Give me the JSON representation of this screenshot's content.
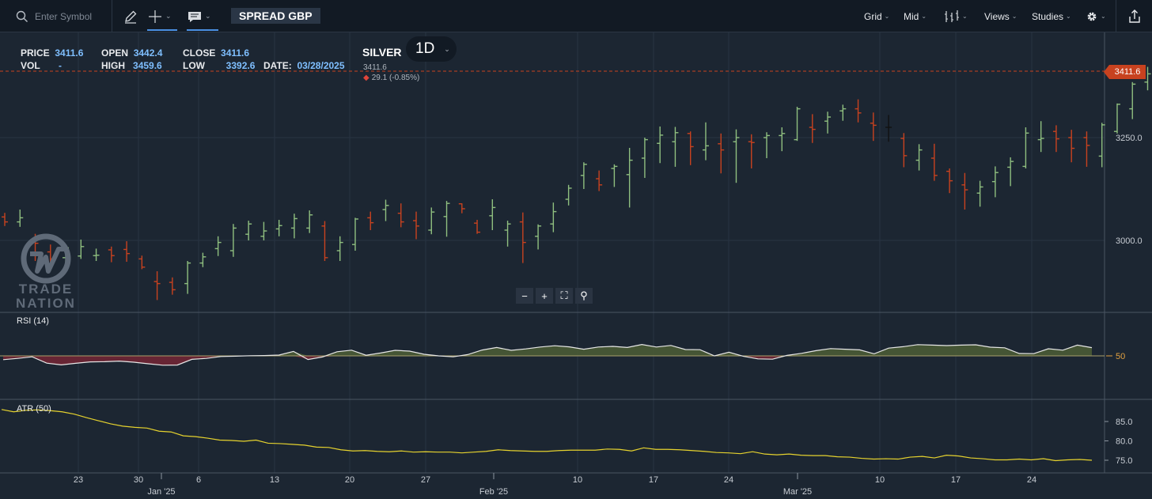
{
  "toolbar": {
    "search_placeholder": "Enter Symbol",
    "symbol": "SPREAD GBP",
    "right": {
      "grid": "Grid",
      "mid": "Mid",
      "views": "Views",
      "studies": "Studies"
    },
    "icons": [
      "search-icon",
      "pencil-icon",
      "crosshair-icon",
      "comment-icon",
      "bar-style-icon",
      "gear-icon",
      "share-icon"
    ]
  },
  "header": {
    "price_label": "PRICE",
    "price": "3411.6",
    "vol_label": "VOL",
    "vol": "-",
    "open_label": "OPEN",
    "open": "3442.4",
    "high_label": "HIGH",
    "high": "3459.6",
    "close_label": "CLOSE",
    "close": "3411.6",
    "low_label": "LOW",
    "low": "3392.6",
    "date_label": "DATE:",
    "date": "03/28/2025"
  },
  "instrument": {
    "name": "SILVER",
    "timeframe": "1D",
    "last": "3411.6",
    "change": "29.1 (-0.85%)"
  },
  "last_price_badge": "3411.6",
  "watermark": {
    "text_top": "TRADE",
    "text_bottom": "NATION"
  },
  "zoom_controls": [
    "minus-icon",
    "plus-icon",
    "fullscreen-icon",
    "zoom-reset-icon"
  ],
  "colors": {
    "up": "#8fbf7f",
    "down": "#c8421f",
    "neutral": "#111111",
    "rsi_up_fill": "#4a5b35",
    "rsi_down_fill": "#6b2535",
    "atr_line": "#e5d22e",
    "last_price": "#c8421f"
  },
  "chart_data": [
    {
      "type": "ohlc",
      "title": "SILVER",
      "y_ticks": [
        "3250.0",
        "3000.0"
      ],
      "ylim": [
        2880,
        3560
      ],
      "x_labels": [
        "23",
        "30",
        "6",
        "13",
        "20",
        "27",
        "10",
        "17",
        "24",
        "10",
        "17",
        "24"
      ],
      "x_month_labels": [
        "Jan '25",
        "Feb '25",
        "Mar '25"
      ],
      "last_price": 3411.6,
      "bars": [
        [
          3057,
          3067,
          3035,
          3045
        ],
        [
          3045,
          3075,
          3033,
          3055
        ],
        [
          2999,
          3016,
          2950,
          2993
        ],
        [
          2972,
          2990,
          2935,
          2955
        ],
        [
          2958,
          2989,
          2934,
          2982
        ],
        [
          2962,
          3002,
          2955,
          2985
        ],
        [
          2963,
          2980,
          2950,
          2964
        ],
        [
          2977,
          2985,
          2947,
          2963
        ],
        [
          2978,
          2998,
          2948,
          2968
        ],
        [
          2955,
          2963,
          2930,
          2935
        ],
        [
          2900,
          2925,
          2855,
          2895
        ],
        [
          2898,
          2910,
          2868,
          2880
        ],
        [
          2895,
          2950,
          2870,
          2945
        ],
        [
          2945,
          2970,
          2935,
          2960
        ],
        [
          2980,
          3010,
          2962,
          2995
        ],
        [
          2975,
          3040,
          2960,
          3030
        ],
        [
          3015,
          3048,
          3000,
          3040
        ],
        [
          3010,
          3045,
          3000,
          3023
        ],
        [
          3028,
          3050,
          3010,
          3036
        ],
        [
          3030,
          3065,
          3005,
          3053
        ],
        [
          3030,
          3073,
          3018,
          3062
        ],
        [
          3035,
          3047,
          2950,
          2958
        ],
        [
          2975,
          3010,
          2950,
          2995
        ],
        [
          2990,
          3055,
          2975,
          3052
        ],
        [
          3055,
          3070,
          3025,
          3043
        ],
        [
          3075,
          3099,
          3047,
          3085
        ],
        [
          3066,
          3090,
          3032,
          3045
        ],
        [
          3048,
          3070,
          3003,
          3035
        ],
        [
          3025,
          3080,
          3015,
          3069
        ],
        [
          3058,
          3096,
          3009,
          3090
        ],
        [
          3089,
          3090,
          3066,
          3077
        ],
        [
          3042,
          3050,
          3016,
          3020
        ],
        [
          3060,
          3100,
          3025,
          3080
        ],
        [
          3025,
          3048,
          2985,
          3040
        ],
        [
          3045,
          3068,
          2945,
          2995
        ],
        [
          3010,
          3039,
          2978,
          3035
        ],
        [
          3040,
          3092,
          3020,
          3070
        ],
        [
          3100,
          3135,
          3085,
          3127
        ],
        [
          3158,
          3190,
          3125,
          3185
        ],
        [
          3150,
          3170,
          3120,
          3135
        ],
        [
          3175,
          3185,
          3130,
          3180
        ],
        [
          3160,
          3225,
          3080,
          3195
        ],
        [
          3200,
          3250,
          3152,
          3245
        ],
        [
          3236,
          3277,
          3188,
          3256
        ],
        [
          3240,
          3276,
          3179,
          3262
        ],
        [
          3260,
          3265,
          3183,
          3228
        ],
        [
          3220,
          3287,
          3195,
          3230
        ],
        [
          3235,
          3260,
          3163,
          3220
        ],
        [
          3240,
          3270,
          3140,
          3250
        ],
        [
          3240,
          3258,
          3175,
          3238
        ],
        [
          3250,
          3263,
          3200,
          3255
        ],
        [
          3255,
          3275,
          3217,
          3260
        ],
        [
          3245,
          3325,
          3242,
          3320
        ],
        [
          3275,
          3307,
          3237,
          3270
        ],
        [
          3290,
          3313,
          3260,
          3300
        ],
        [
          3315,
          3330,
          3291,
          3320
        ],
        [
          3320,
          3343,
          3287,
          3310
        ],
        [
          3285,
          3311,
          3242,
          3280
        ],
        [
          3275,
          3305,
          3240,
          3275
        ],
        [
          3248,
          3261,
          3178,
          3206
        ],
        [
          3195,
          3234,
          3170,
          3220
        ],
        [
          3200,
          3235,
          3145,
          3158
        ],
        [
          3168,
          3175,
          3115,
          3145
        ],
        [
          3135,
          3164,
          3075,
          3123
        ],
        [
          3115,
          3145,
          3082,
          3130
        ],
        [
          3143,
          3180,
          3105,
          3165
        ],
        [
          3178,
          3202,
          3132,
          3192
        ],
        [
          3180,
          3275,
          3175,
          3261
        ],
        [
          3245,
          3290,
          3215,
          3248
        ],
        [
          3265,
          3280,
          3215,
          3247
        ],
        [
          3250,
          3269,
          3190,
          3224
        ],
        [
          3250,
          3265,
          3179,
          3231
        ],
        [
          3205,
          3286,
          3178,
          3281
        ],
        [
          3265,
          3333,
          3260,
          3331
        ],
        [
          3320,
          3385,
          3295,
          3380
        ],
        [
          3385,
          3422,
          3365,
          3405
        ],
        [
          3395,
          3409,
          3343,
          3394
        ],
        [
          3390,
          3412,
          3358,
          3381
        ],
        [
          3395,
          3428,
          3391,
          3415
        ],
        [
          3405,
          3418,
          3362,
          3388
        ],
        [
          3388,
          3405,
          3339,
          3353
        ],
        [
          3360,
          3386,
          3307,
          3343
        ],
        [
          3345,
          3374,
          3266,
          3330
        ],
        [
          3330,
          3355,
          3310,
          3335
        ],
        [
          3320,
          3360,
          3315,
          3335
        ],
        [
          3345,
          3372,
          3294,
          3368
        ],
        [
          3370,
          3395,
          3356,
          3377
        ],
        [
          3362,
          3392,
          3352,
          3387
        ],
        [
          3400,
          3440,
          3370,
          3436
        ],
        [
          3442,
          3460,
          3392,
          3411.6
        ]
      ]
    },
    {
      "type": "area",
      "title": "RSI (14)",
      "y_ticks": [
        "50"
      ],
      "ylim": [
        25,
        75
      ],
      "values": [
        47.6,
        48.4,
        49.4,
        45.4,
        44.3,
        45.3,
        46.2,
        46.3,
        46.7,
        46.0,
        45.0,
        44.1,
        44.2,
        47.8,
        48.4,
        49.6,
        49.8,
        50.1,
        50.2,
        50.5,
        52.8,
        47.7,
        49.3,
        52.6,
        53.6,
        50.4,
        51.8,
        53.5,
        53.0,
        51.0,
        50.0,
        49.4,
        50.8,
        53.7,
        55.3,
        53.5,
        54.4,
        55.6,
        56.4,
        55.7,
        54.2,
        55.6,
        56.0,
        55.3,
        57.2,
        55.6,
        56.6,
        54.0,
        53.9,
        50.0,
        52.3,
        49.7,
        48.1,
        47.9,
        50.3,
        51.6,
        53.3,
        54.6,
        54.2,
        53.8,
        51.3,
        54.9,
        55.8,
        57.1,
        56.8,
        56.5,
        56.8,
        57.0,
        55.5,
        55.1,
        51.5,
        51.4,
        54.5,
        53.6,
        56.8,
        55.2
      ]
    },
    {
      "type": "line",
      "title": "ATR (50)",
      "y_ticks": [
        "85.0",
        "80.0",
        "75.0"
      ],
      "ylim": [
        72.5,
        91
      ],
      "values": [
        88.1,
        87.5,
        87.9,
        88.0,
        87.8,
        87.5,
        86.9,
        86.0,
        85.2,
        84.4,
        83.8,
        83.5,
        83.3,
        82.5,
        82.3,
        81.3,
        81.1,
        80.7,
        80.2,
        80.1,
        79.9,
        80.2,
        79.4,
        79.3,
        79.1,
        78.9,
        78.4,
        78.3,
        77.7,
        77.4,
        77.5,
        77.3,
        77.2,
        77.4,
        77.1,
        77.2,
        77.1,
        77.1,
        76.9,
        77.1,
        77.3,
        77.7,
        77.5,
        77.4,
        77.3,
        77.3,
        77.5,
        77.6,
        77.6,
        77.6,
        77.9,
        77.8,
        77.4,
        78.2,
        77.8,
        77.8,
        77.7,
        77.5,
        77.3,
        77.0,
        76.9,
        76.7,
        77.2,
        76.6,
        76.4,
        76.6,
        76.3,
        76.2,
        76.2,
        75.9,
        75.8,
        75.5,
        75.3,
        75.4,
        75.3,
        75.8,
        76.0,
        75.6,
        76.3,
        76.1,
        75.6,
        75.4,
        75.1,
        75.1,
        75.3,
        75.1,
        75.4,
        74.9,
        75.1,
        75.2,
        75.0
      ]
    }
  ]
}
